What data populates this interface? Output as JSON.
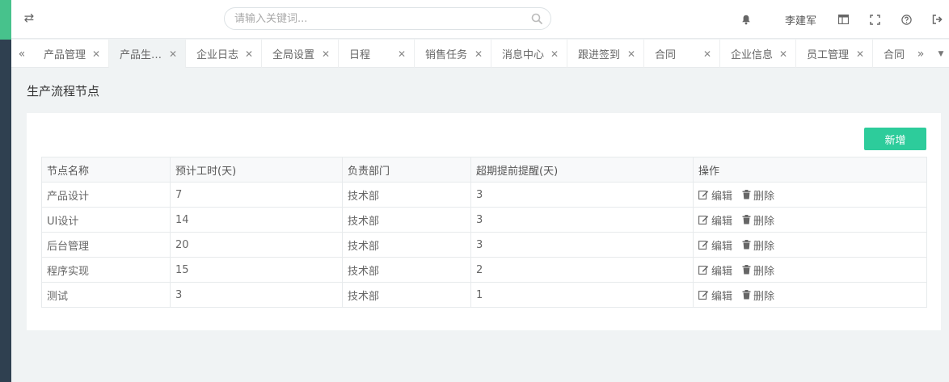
{
  "header": {
    "search_placeholder": "请输入关键词...",
    "user_name": "李建军"
  },
  "tabs": [
    {
      "label": "产品管理",
      "active": false
    },
    {
      "label": "产品生…",
      "active": true
    },
    {
      "label": "企业日志",
      "active": false
    },
    {
      "label": "全局设置",
      "active": false
    },
    {
      "label": "日程",
      "active": false
    },
    {
      "label": "销售任务",
      "active": false
    },
    {
      "label": "消息中心",
      "active": false
    },
    {
      "label": "跟进签到",
      "active": false
    },
    {
      "label": "合同",
      "active": false
    },
    {
      "label": "企业信息",
      "active": false
    },
    {
      "label": "员工管理",
      "active": false
    },
    {
      "label": "合同",
      "active": false
    }
  ],
  "page": {
    "title": "生产流程节点",
    "add_button": "新增"
  },
  "table": {
    "columns": [
      "节点名称",
      "预计工时(天)",
      "负责部门",
      "超期提前提醒(天)",
      "操作"
    ],
    "rows": [
      {
        "name": "产品设计",
        "hours": "7",
        "dept": "技术部",
        "remind": "3"
      },
      {
        "name": "UI设计",
        "hours": "14",
        "dept": "技术部",
        "remind": "3"
      },
      {
        "name": "后台管理",
        "hours": "20",
        "dept": "技术部",
        "remind": "3"
      },
      {
        "name": "程序实现",
        "hours": "15",
        "dept": "技术部",
        "remind": "2"
      },
      {
        "name": "测试",
        "hours": "3",
        "dept": "技术部",
        "remind": "1"
      }
    ],
    "edit_label": "编辑",
    "delete_label": "删除"
  },
  "colors": {
    "accent": "#47c28c",
    "add_button": "#2dcc9b",
    "sidebar": "#2f4050"
  }
}
